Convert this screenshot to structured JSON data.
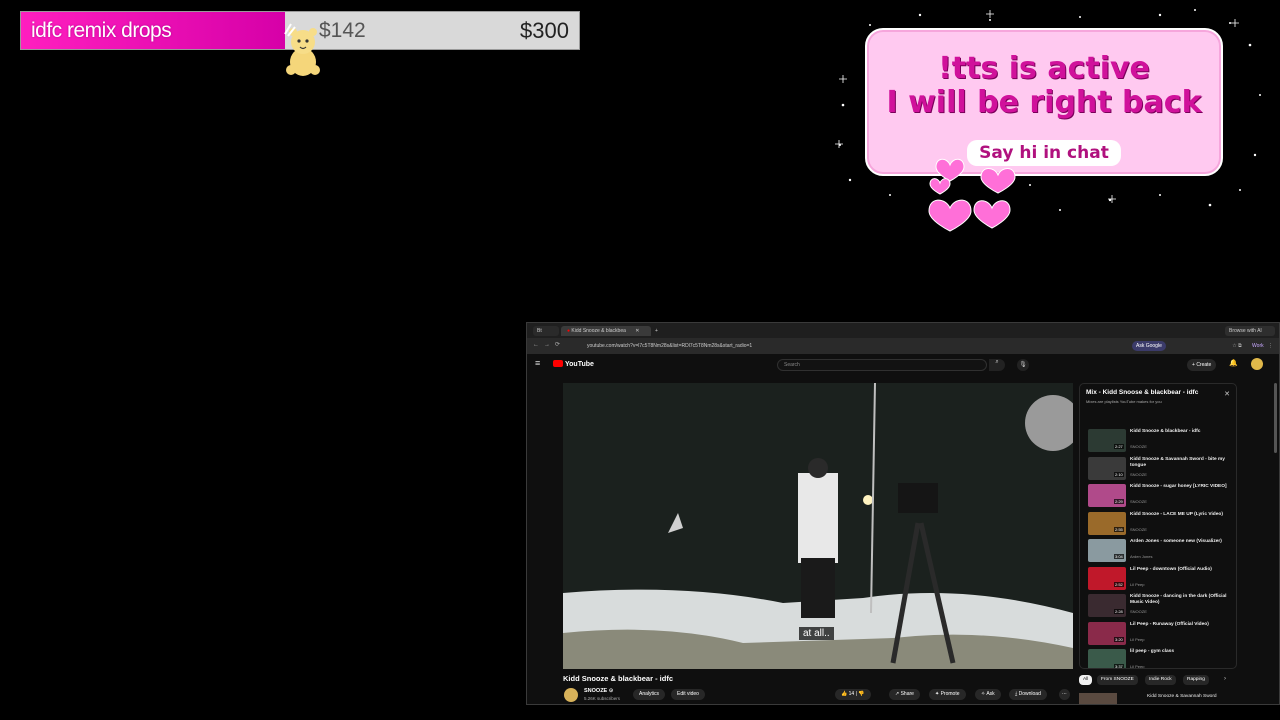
{
  "goal": {
    "label": "idfc remix drops",
    "current": "$142",
    "target": "$300",
    "progress_fraction": 0.473,
    "fill_color": "#e80bb7"
  },
  "brb": {
    "line1": "!tts is active",
    "line2": "I will be right back",
    "chat": "Say hi in chat",
    "card_color": "#ffc9f0",
    "text_color": "#d0119b"
  },
  "browser": {
    "tabs": {
      "pinned": "Bt",
      "active": "Kidd Snooze & blackbea",
      "new_tab": "+",
      "browse_ai": "Browse with AI"
    },
    "url": "youtube.com/watch?v=l7c5T8Nm28s&list=RDl7c5T8Nm28s&start_radio=1",
    "ask_google": "Ask Google",
    "work_badge": "Work"
  },
  "youtube": {
    "logo": "YouTube",
    "search_placeholder": "Search",
    "create_label": "Create",
    "caption": "at all..",
    "video_title": "Kidd Snooze & blackbear - idfc",
    "channel_name": "SNOOZE ⊙",
    "channel_subs": "5.26K subscribers",
    "buttons": {
      "analytics": "Analytics",
      "edit_video": "Edit video",
      "likes": "14",
      "share": "Share",
      "promote": "Promote",
      "ask": "Ask",
      "download": "Download",
      "more": "⋯"
    },
    "mix": {
      "title": "Mix - Kidd Snoose & blackbear - idfc",
      "subtitle": "Mixes are playlists YouTube makes for you",
      "items": [
        {
          "title": "Kidd Snooze & blackbear - idfc",
          "channel": "SNOOZE",
          "duration": "2:27",
          "thumb": "#2c3a33"
        },
        {
          "title": "Kidd Snooze & Savannah Sword - bite my tongue",
          "channel": "SNOOZE",
          "duration": "2:10",
          "thumb": "#3a3a3a"
        },
        {
          "title": "Kidd Snooze - sugar honey [LYRIC VIDEO]",
          "channel": "SNOOZE",
          "duration": "2:29",
          "thumb": "#b04a8a"
        },
        {
          "title": "Kidd Snooze - LACE ME UP (Lyric Video)",
          "channel": "SNOOZE",
          "duration": "2:55",
          "thumb": "#9a6a2a"
        },
        {
          "title": "Arden Jones - someone new (Visualizer)",
          "channel": "Arden Jones",
          "duration": "3:04",
          "thumb": "#8a9aa0"
        },
        {
          "title": "Lil Peep - downtown (Official Audio)",
          "channel": "Lil Peep",
          "duration": "2:52",
          "thumb": "#c0182a"
        },
        {
          "title": "Kidd Snooze - dancing in the dark (Official Music Video)",
          "channel": "SNOOZE",
          "duration": "2:28",
          "thumb": "#3a2a30"
        },
        {
          "title": "Lil Peep - Runaway (Official Video)",
          "channel": "Lil Peep",
          "duration": "3:20",
          "thumb": "#8a2a4a"
        },
        {
          "title": "lil peep - gym class",
          "channel": "Lil Peep",
          "duration": "3:37",
          "thumb": "#3a5a4a"
        }
      ]
    },
    "chips": [
      "All",
      "From SNOOZE",
      "Indie Rock",
      "Rapping"
    ],
    "next_title": "Kidd Snooze & Savannah Sword"
  }
}
